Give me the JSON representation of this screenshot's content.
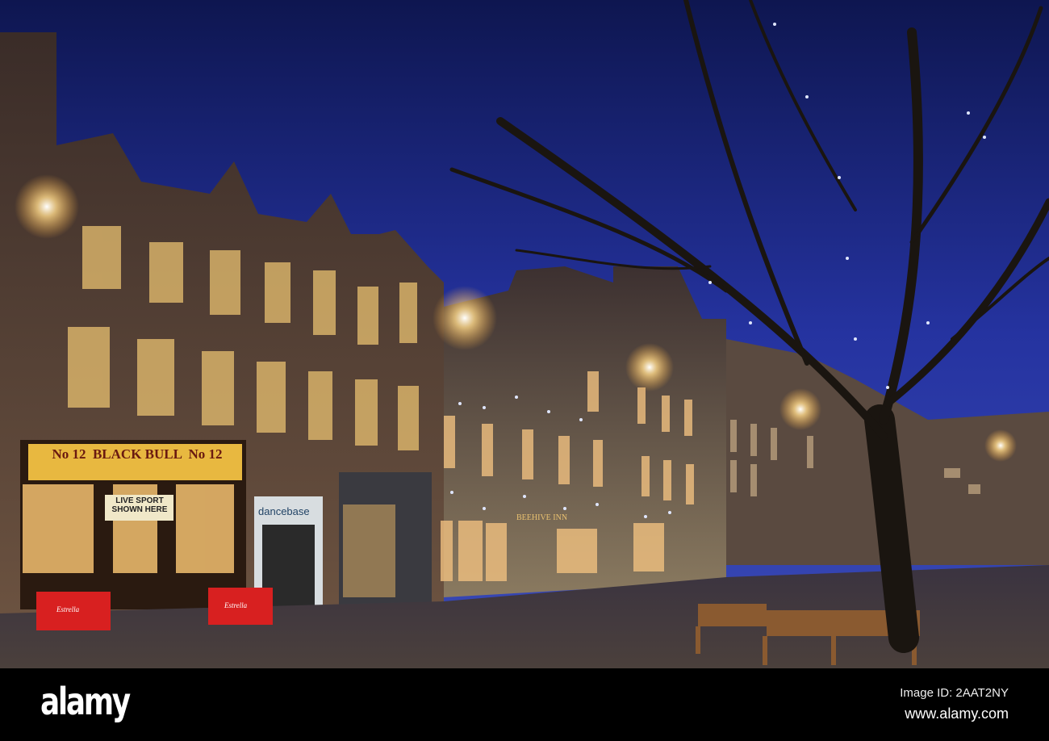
{
  "photo": {
    "pub_sign": "No 12  BLACK BULL  No 12",
    "banner": "LIVE SPORT SHOWN HERE",
    "shop_sign": "dancebase",
    "inn_sign": "BEEHIVE INN",
    "barrier_label": "Estrella",
    "sky_color": "#1a2a8a"
  },
  "watermark": {
    "logo": "alamy",
    "image_id": "Image ID: 2AAT2NY",
    "url": "www.alamy.com"
  }
}
